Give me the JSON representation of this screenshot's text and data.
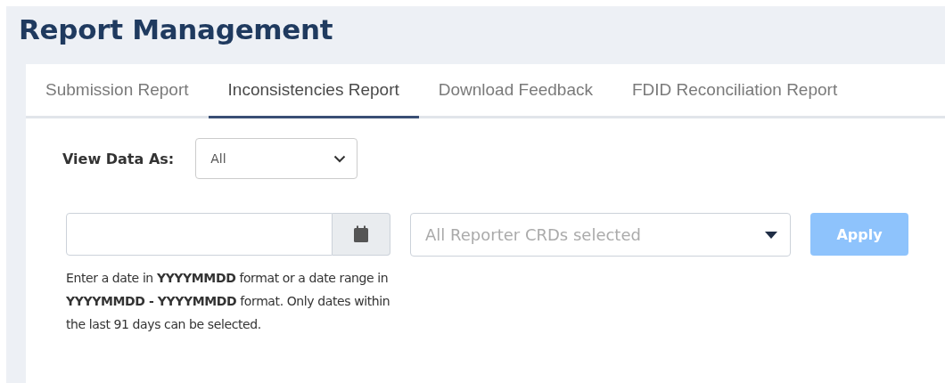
{
  "page_title": "Report Management",
  "tabs": [
    {
      "label": "Submission Report",
      "selected": false
    },
    {
      "label": "Inconsistencies Report",
      "selected": true
    },
    {
      "label": "Download Feedback",
      "selected": false
    },
    {
      "label": "FDID Reconciliation Report",
      "selected": false
    }
  ],
  "view_data_as": {
    "label": "View Data As:",
    "value": "All"
  },
  "date_field": {
    "help": "Enter a date in **YYYYMMDD** format or a date range in **YYYYMMDD - YYYYMMDD** format. Only dates within the last 91 days can be selected."
  },
  "reporter_select": {
    "placeholder": "All Reporter CRDs selected"
  },
  "apply_button": {
    "label": "Apply",
    "disabled": true
  }
}
